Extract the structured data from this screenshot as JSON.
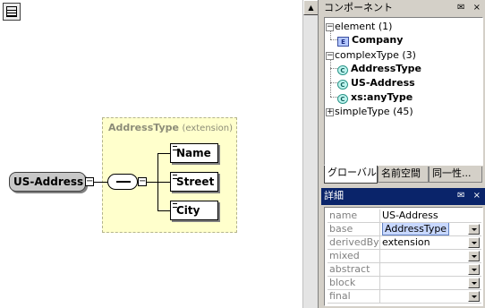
{
  "diagram": {
    "root_element": "US-Address",
    "extension_type": "AddressType",
    "extension_kind": "(extension)",
    "toggle_minus": "−",
    "children": [
      "Name",
      "Street",
      "City"
    ],
    "colors": {
      "extension_bg": "#ffffcc",
      "root_bg": "#c8c8c8"
    }
  },
  "components_panel": {
    "title": "コンポーネント",
    "pin": "✉",
    "close": "×",
    "expand_minus": "−",
    "expand_plus": "+",
    "tree": [
      {
        "label": "element",
        "count": "(1)",
        "children": [
          {
            "icon": "E",
            "label": "Company"
          }
        ]
      },
      {
        "label": "complexType",
        "count": "(3)",
        "children": [
          {
            "icon": "C",
            "label": "AddressType"
          },
          {
            "icon": "C",
            "label": "US-Address"
          },
          {
            "icon": "C",
            "label": "xs:anyType"
          }
        ]
      },
      {
        "label": "simpleType",
        "count": "(45)",
        "children": []
      }
    ],
    "tabs": [
      "グローバル",
      "名前空間",
      "同一性..."
    ]
  },
  "details_panel": {
    "title": "詳細",
    "pin": "✉",
    "close": "×",
    "properties": [
      {
        "name": "name",
        "value": "US-Address",
        "dropdown": false
      },
      {
        "name": "base",
        "value": "AddressType",
        "dropdown": true,
        "selected": true
      },
      {
        "name": "derivedBy",
        "value": "extension",
        "dropdown": true
      },
      {
        "name": "mixed",
        "value": "",
        "dropdown": true
      },
      {
        "name": "abstract",
        "value": "",
        "dropdown": true
      },
      {
        "name": "block",
        "value": "",
        "dropdown": true
      },
      {
        "name": "final",
        "value": "",
        "dropdown": true
      }
    ]
  },
  "scrollbar": {
    "up_arrow": "▲"
  }
}
